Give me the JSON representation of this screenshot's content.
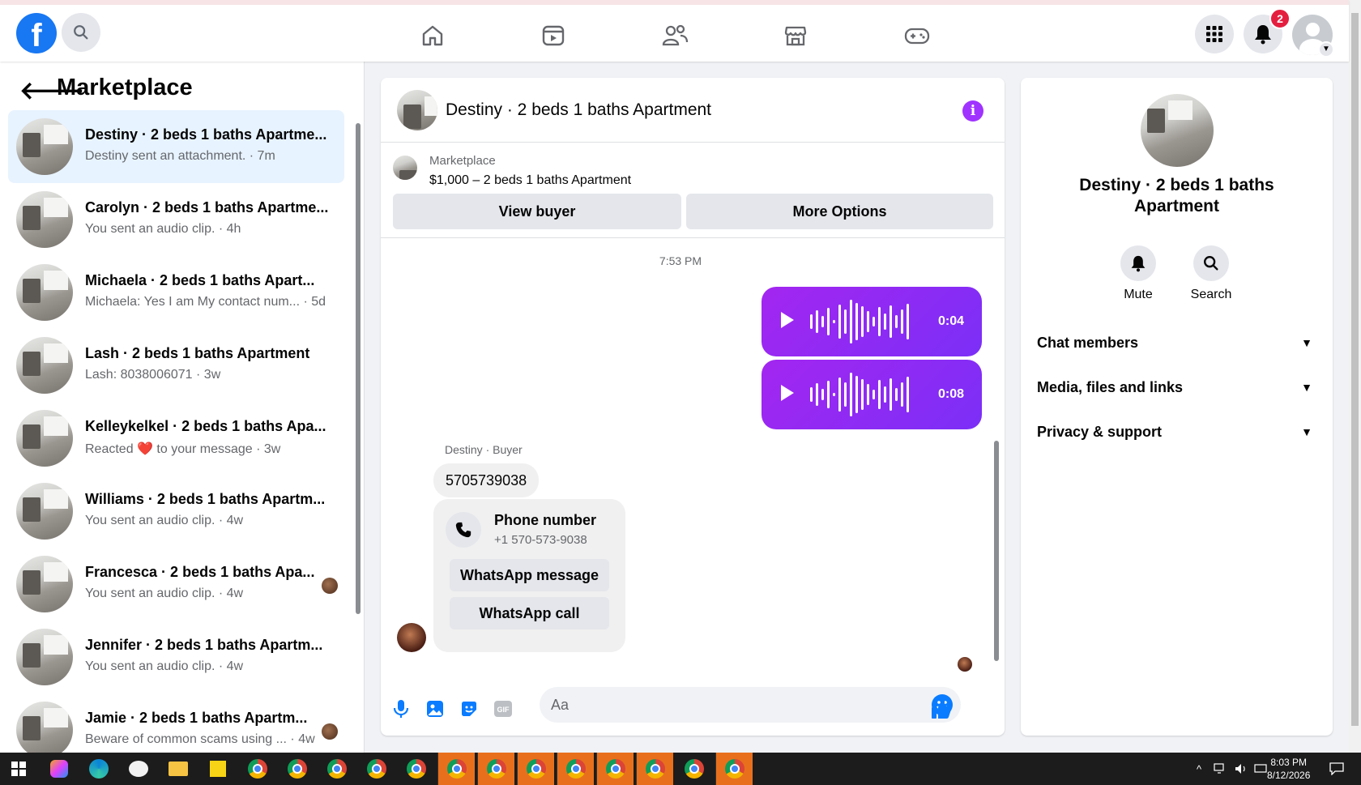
{
  "nav": {
    "logo_letter": "f",
    "notifications_count": "2"
  },
  "sidebar": {
    "title": "Marketplace",
    "conversations": [
      {
        "title": "Destiny · 2 beds 1 baths Apartme...",
        "subtitle": "Destiny sent an attachment. · 7m",
        "active": true
      },
      {
        "title": "Carolyn · 2 beds 1 baths Apartme...",
        "subtitle": "You sent an audio clip. · 4h"
      },
      {
        "title": "Michaela · 2 beds 1 baths Apart...",
        "subtitle": "Michaela: Yes I am My contact num...  · 5d"
      },
      {
        "title": "Lash · 2 beds 1 baths Apartment",
        "subtitle": "Lash: 8038006071 · 3w"
      },
      {
        "title": "Kelleykelkel · 2 beds 1 baths Apa...",
        "subtitle": "Reacted ❤️ to your message · 3w"
      },
      {
        "title": "Williams · 2 beds 1 baths Apartm...",
        "subtitle": "You sent an audio clip. · 4w"
      },
      {
        "title": "Francesca · 2 beds 1 baths Apa...",
        "subtitle": "You sent an audio clip. · 4w"
      },
      {
        "title": "Jennifer · 2 beds 1 baths Apartm...",
        "subtitle": "You sent an audio clip. · 4w"
      },
      {
        "title": "Jamie · 2 beds 1 baths Apartm...",
        "subtitle": "Beware of common scams using ... · 4w"
      }
    ]
  },
  "chat": {
    "header_title": "Destiny · 2 beds 1 baths Apartment",
    "marketplace_label": "Marketplace",
    "listing": "$1,000 – 2 beds 1 baths Apartment",
    "view_buyer_label": "View buyer",
    "more_options_label": "More Options",
    "timestamp": "7:53 PM",
    "audio_messages": [
      {
        "duration": "0:04"
      },
      {
        "duration": "0:08"
      }
    ],
    "sender_label": "Destiny · Buyer",
    "message_text": "5705739038",
    "phone_card": {
      "title": "Phone number",
      "number": "+1 570-573-9038",
      "whatsapp_message_label": "WhatsApp message",
      "whatsapp_call_label": "WhatsApp call"
    },
    "composer_placeholder": "Aa"
  },
  "details": {
    "title": "Destiny · 2 beds 1 baths Apartment",
    "mute_label": "Mute",
    "search_label": "Search",
    "sections": [
      "Chat members",
      "Media, files and links",
      "Privacy & support"
    ]
  },
  "taskbar": {
    "time": "8:03 PM",
    "date": "8/12/2026"
  },
  "colors": {
    "brand": "#1877f2",
    "messenger_purple": "#a033ff",
    "active_conv": "#e7f3ff",
    "notification_red": "#e41e3f",
    "taskbar_active": "#e8701c"
  }
}
